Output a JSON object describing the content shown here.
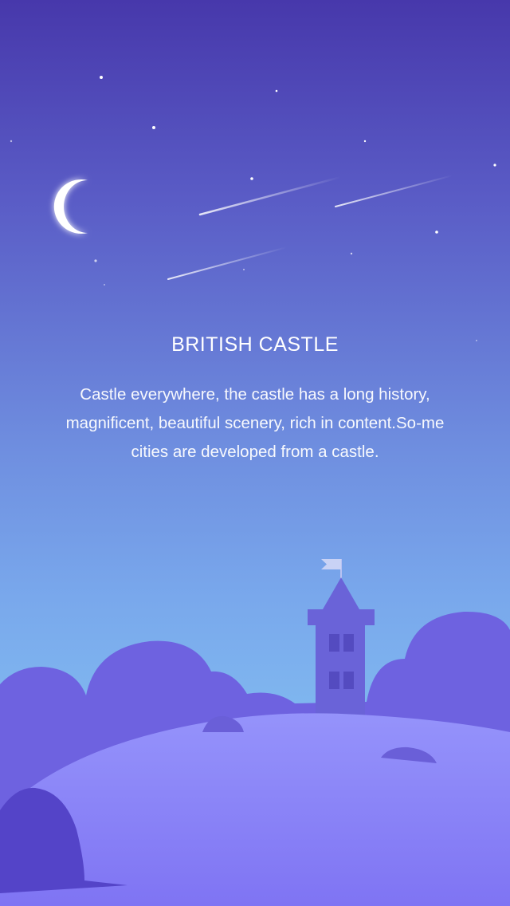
{
  "title": "BRITISH CASTLE",
  "description": "Castle everywhere, the castle has a long history, magnificent, beautiful scenery, rich in content.So-me cities are developed from a castle.",
  "colors": {
    "sky_top": "#4738ab",
    "sky_bottom": "#83bdf0",
    "hill": "#8a84f7",
    "trees": "#6e62e0",
    "dark_tree": "#5444c8",
    "tower": "#6a63d8",
    "moon": "#ffffff"
  },
  "icons": [
    "moon-icon",
    "flag-icon"
  ]
}
